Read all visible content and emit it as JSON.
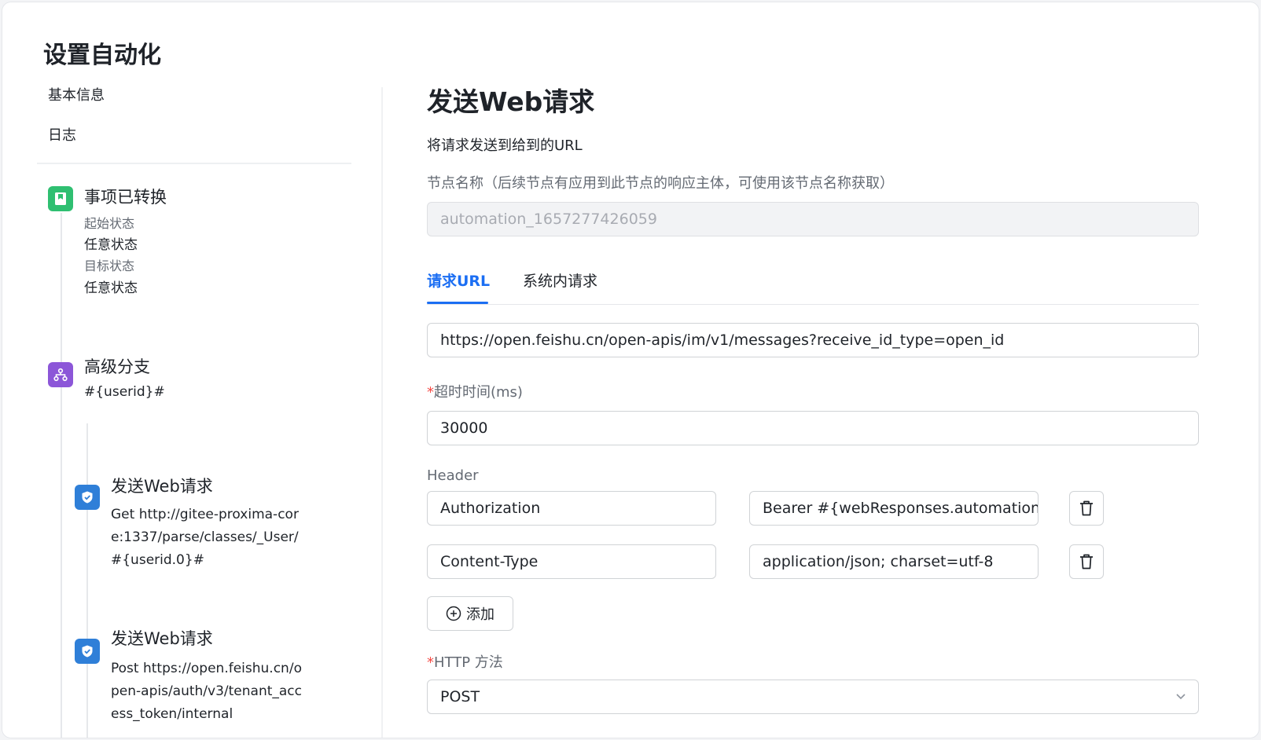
{
  "page_title": "设置自动化",
  "nav": {
    "basic_info": "基本信息",
    "log": "日志"
  },
  "flow": {
    "trigger": {
      "title": "事项已转换",
      "from_label": "起始状态",
      "from_value": "任意状态",
      "to_label": "目标状态",
      "to_value": "任意状态",
      "icon": "bookmark-icon",
      "color": "#2fbf71"
    },
    "branch": {
      "title": "高级分支",
      "expr": "#{userid}#",
      "icon": "branch-icon",
      "color": "#8c56d8"
    },
    "steps": [
      {
        "title": "发送Web请求",
        "desc": "Get http://gitee-proxima-core:1337/parse/classes/_User/#{userid.0}#",
        "icon": "shield-icon",
        "color": "#2f7fd8"
      },
      {
        "title": "发送Web请求",
        "desc": "Post https://open.feishu.cn/open-apis/auth/v3/tenant_access_token/internal",
        "icon": "shield-icon",
        "color": "#2f7fd8"
      }
    ]
  },
  "form": {
    "title": "发送Web请求",
    "description": "将请求发送到给到的URL",
    "node_name_label": "节点名称（后续节点有应用到此节点的响应主体，可使用该节点名称获取）",
    "node_name_value": "automation_1657277426059",
    "tabs": [
      "请求URL",
      "系统内请求"
    ],
    "url": "https://open.feishu.cn/open-apis/im/v1/messages?receive_id_type=open_id",
    "timeout_label": "超时时间(ms)",
    "timeout_value": "30000",
    "header_label": "Header",
    "headers": [
      {
        "key": "Authorization",
        "value": "Bearer #{webResponses.automation_"
      },
      {
        "key": "Content-Type",
        "value": "application/json; charset=utf-8"
      }
    ],
    "add_label": "添加",
    "method_label": "HTTP 方法",
    "method_value": "POST",
    "required_mark": "*",
    "accent_color": "#1b6ef3"
  }
}
